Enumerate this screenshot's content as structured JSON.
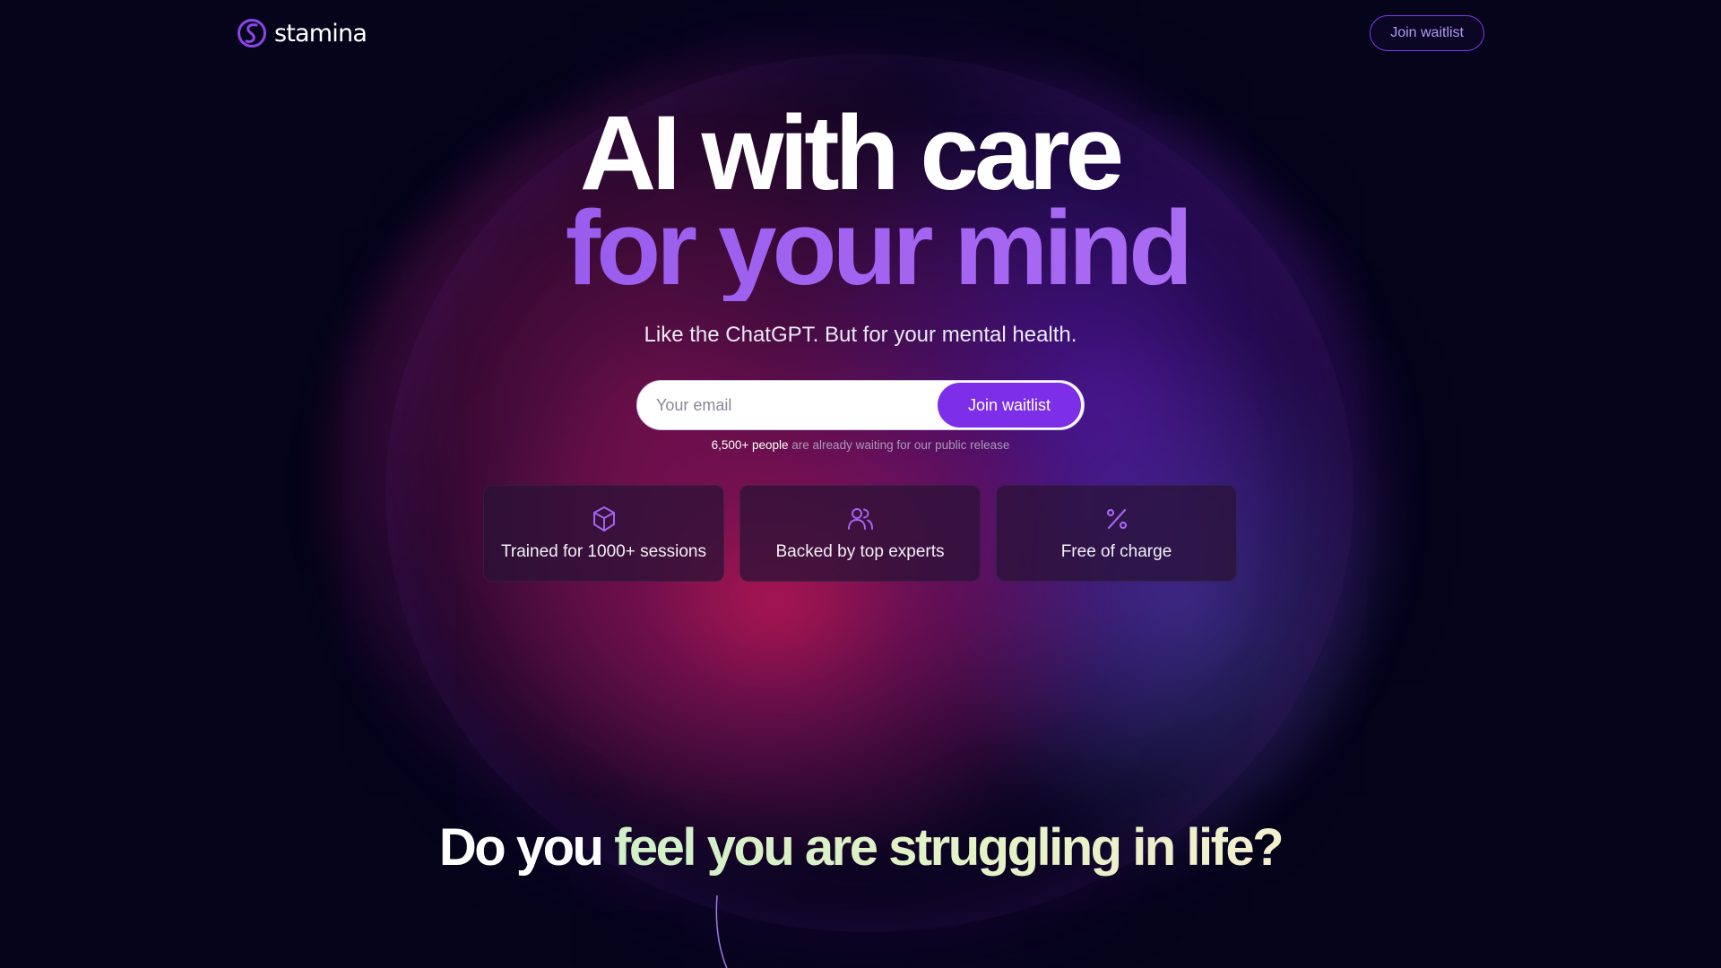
{
  "brand": {
    "name": "stamina"
  },
  "header": {
    "cta_label": "Join waitlist"
  },
  "hero": {
    "headline_line1": "AI with care",
    "headline_line2": "for your mind",
    "subheadline": "Like the ChatGPT. But for your mental health.",
    "email_placeholder": "Your email",
    "submit_label": "Join waitlist",
    "social_proof_count": "6,500+ people",
    "social_proof_text": " are already waiting for our public release"
  },
  "features": [
    {
      "icon": "cube-icon",
      "label": "Trained for 1000+ sessions"
    },
    {
      "icon": "users-icon",
      "label": "Backed by top experts"
    },
    {
      "icon": "percent-icon",
      "label": "Free of charge"
    }
  ],
  "section_question": {
    "plain": "Do you ",
    "highlight": "feel you are struggling in life?"
  },
  "colors": {
    "background": "#05041a",
    "accent_purple": "#7c2ee8",
    "headline_purple": "#9b5cf0",
    "question_green": "#d0f0c8"
  }
}
